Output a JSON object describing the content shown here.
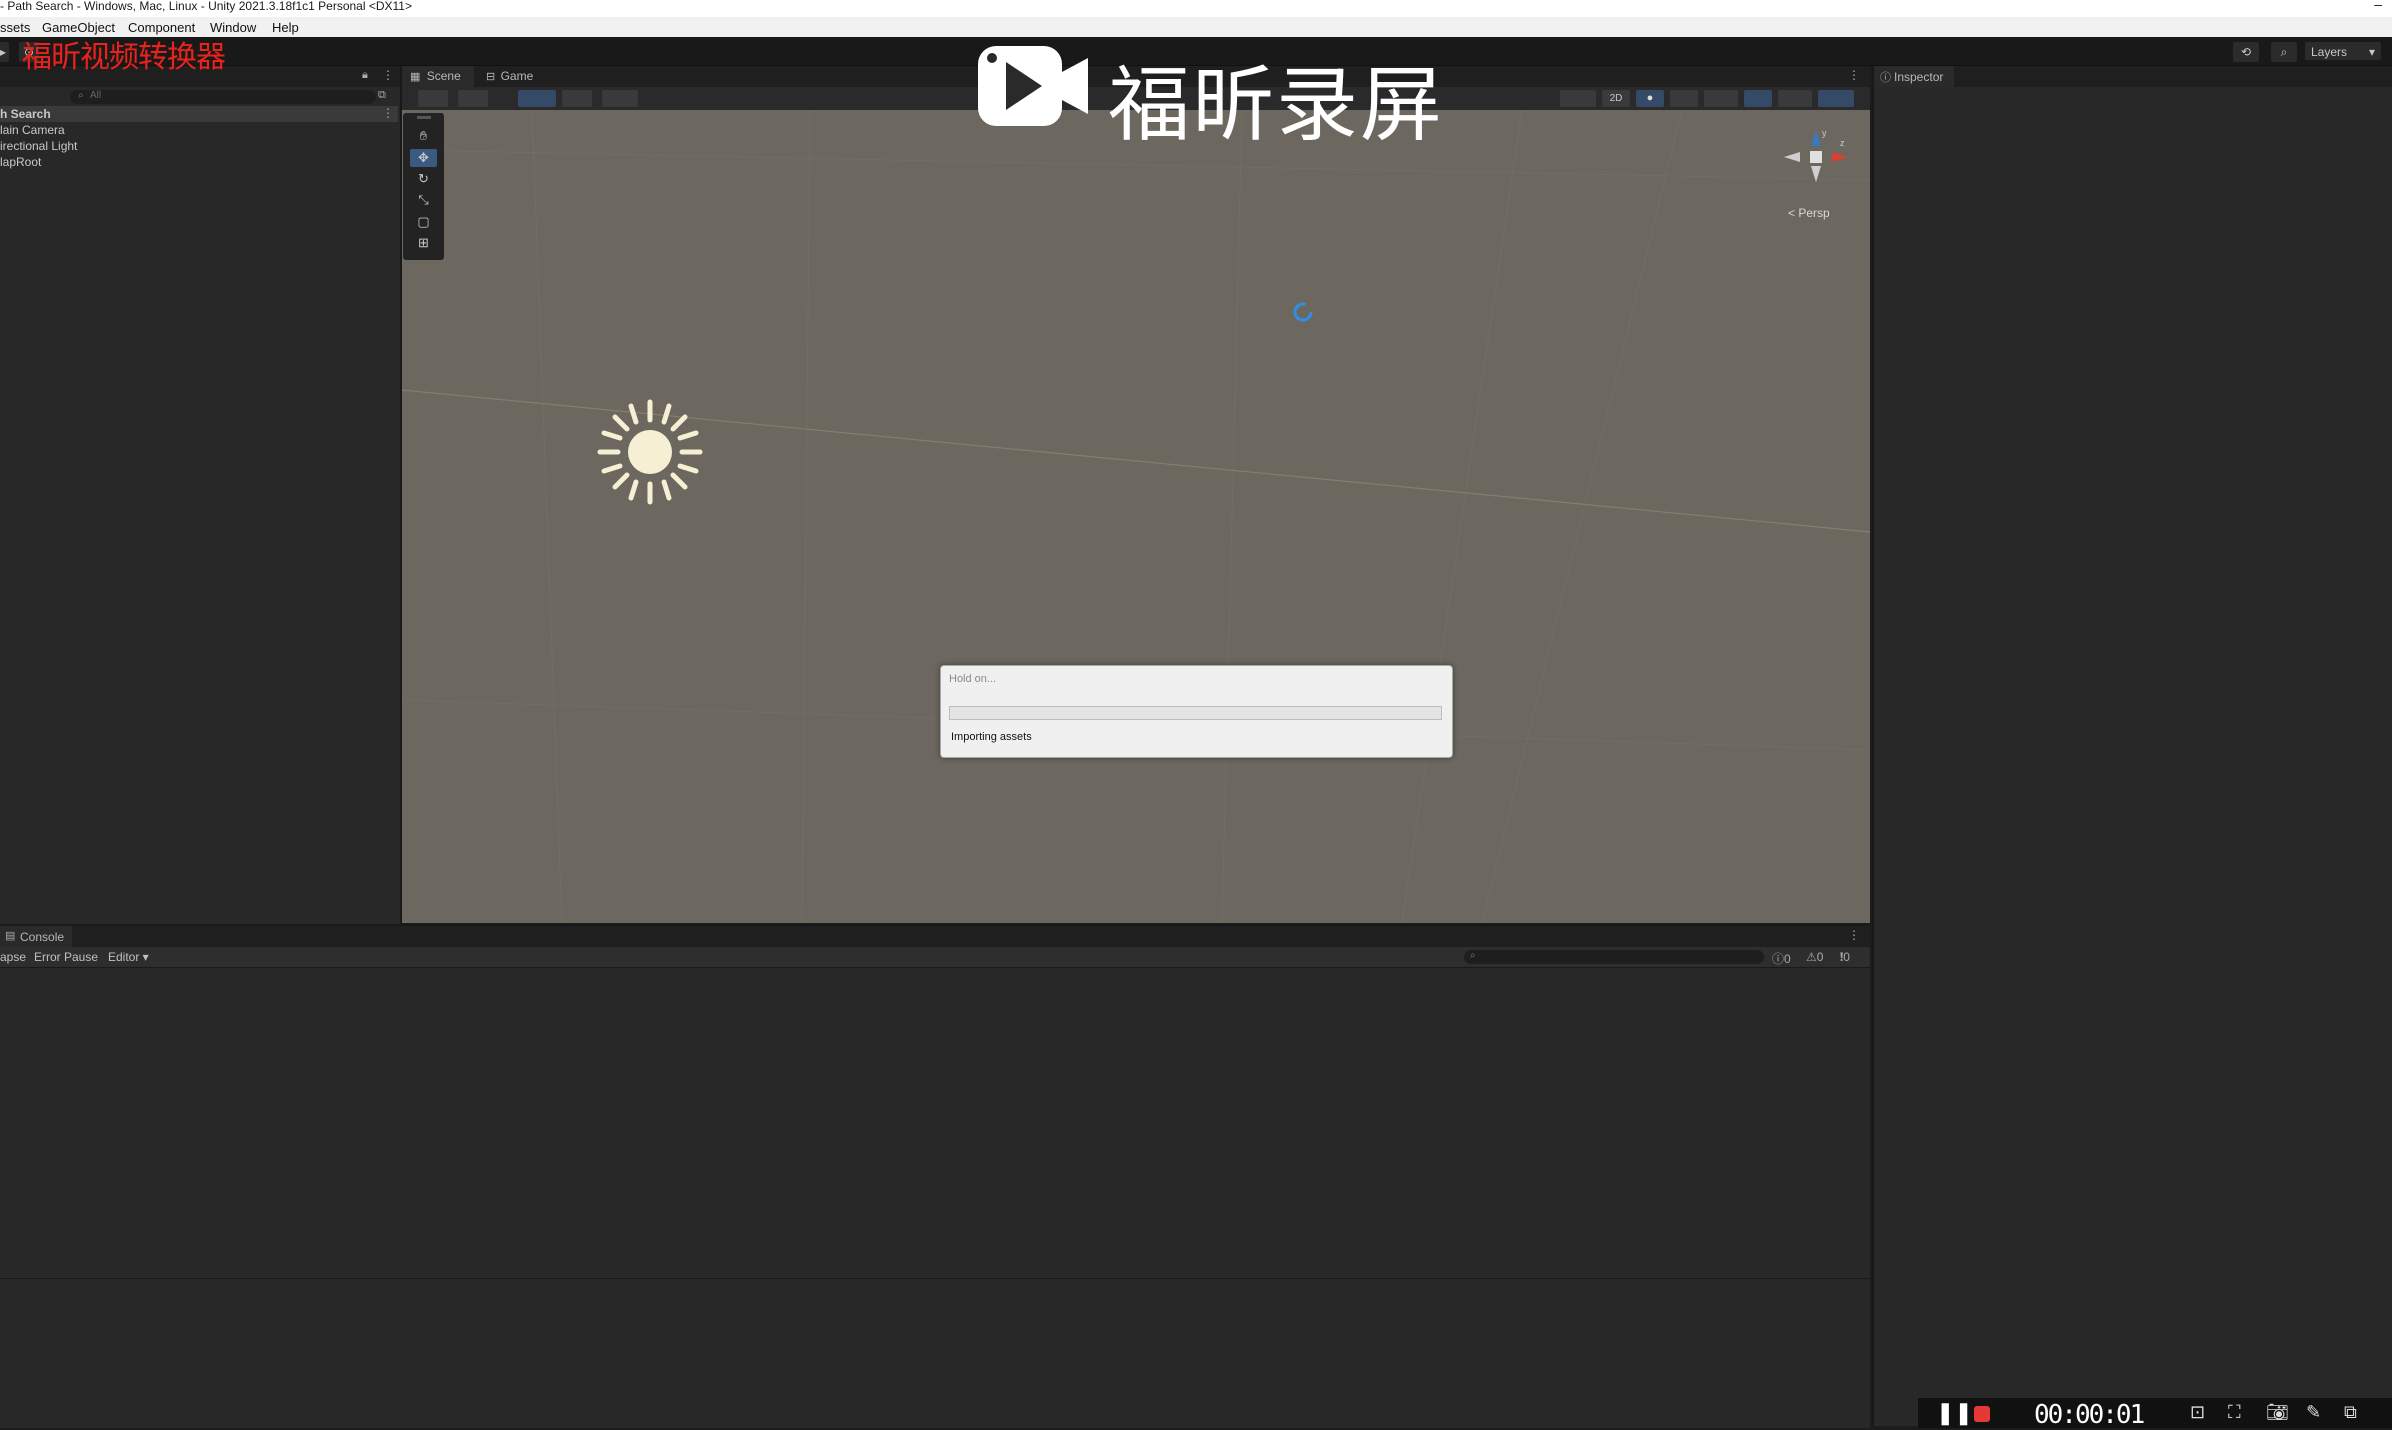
{
  "window": {
    "title": "- Path Search - Windows, Mac, Linux - Unity 2021.3.18f1c1 Personal <DX11>",
    "minimize_glyph": "–"
  },
  "menu": [
    "ssets",
    "GameObject",
    "Component",
    "Window",
    "Help"
  ],
  "toolbar": {
    "layers_label": "Layers",
    "history_icon": "history-icon",
    "search_icon": "search-icon"
  },
  "watermarks": {
    "converter": "福昕视频转换器",
    "recorder": "福昕录屏"
  },
  "hierarchy": {
    "search_placeholder": "All",
    "scene_name": "h Search",
    "items": [
      "lain Camera",
      "irectional Light",
      "lapRoot"
    ]
  },
  "scene": {
    "tabs": [
      {
        "label": "Scene",
        "icon": "grid-icon"
      },
      {
        "label": "Game",
        "icon": "gamepad-icon"
      }
    ],
    "mode_2d": "2D",
    "gizmo_label": "< Persp",
    "gizmo_axes": {
      "y": "y",
      "z": "z"
    },
    "tools": [
      "view-tool",
      "move-tool",
      "rotate-tool",
      "scale-tool",
      "rect-tool",
      "transform-tool"
    ]
  },
  "dialog": {
    "title": "Hold on...",
    "status": "Importing assets",
    "progress": 0.0
  },
  "inspector": {
    "title": "Inspector"
  },
  "console": {
    "title": "Console",
    "buttons": [
      "apse",
      "Error Pause",
      "Editor ▾"
    ],
    "counts": {
      "info": "0",
      "warn": "0",
      "error": "0"
    }
  },
  "recorder": {
    "time": "00:00:01"
  },
  "colors": {
    "scene_bg": "#6c675f",
    "panel_bg": "#282828",
    "accent": "#3a79bb",
    "record_red": "#e53935",
    "watermark_red": "#e8231b"
  }
}
